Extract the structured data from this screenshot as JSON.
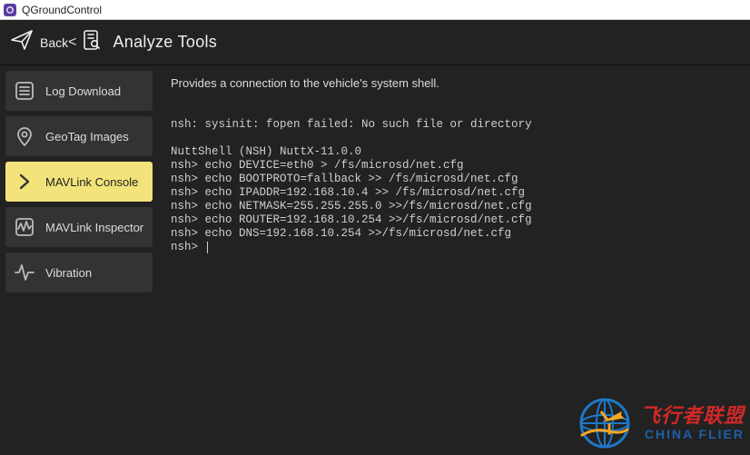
{
  "window": {
    "title": "QGroundControl"
  },
  "header": {
    "back_label": "Back",
    "chevron": "<",
    "page_title": "Analyze Tools"
  },
  "sidebar": {
    "items": [
      {
        "id": "log-download",
        "label": "Log Download",
        "icon": "list-lines-icon",
        "active": false
      },
      {
        "id": "geotag",
        "label": "GeoTag Images",
        "icon": "pin-icon",
        "active": false
      },
      {
        "id": "mavlink-console",
        "label": "MAVLink Console",
        "icon": "chevron-right-icon",
        "active": true
      },
      {
        "id": "mavlink-inspector",
        "label": "MAVLink Inspector",
        "icon": "waveform-box-icon",
        "active": false
      },
      {
        "id": "vibration",
        "label": "Vibration",
        "icon": "pulse-icon",
        "active": false
      }
    ]
  },
  "main": {
    "description": "Provides a connection to the vehicle's system shell.",
    "console_lines": [
      "nsh: sysinit: fopen failed: No such file or directory",
      "",
      "NuttShell (NSH) NuttX-11.0.0",
      "nsh> echo DEVICE=eth0 > /fs/microsd/net.cfg",
      "nsh> echo BOOTPROTO=fallback >> /fs/microsd/net.cfg",
      "nsh> echo IPADDR=192.168.10.4 >> /fs/microsd/net.cfg",
      "nsh> echo NETMASK=255.255.255.0 >>/fs/microsd/net.cfg",
      "nsh> echo ROUTER=192.168.10.254 >>/fs/microsd/net.cfg",
      "nsh> echo DNS=192.168.10.254 >>/fs/microsd/net.cfg"
    ],
    "prompt": "nsh> "
  },
  "watermark": {
    "line1": "飞行者联盟",
    "line2": "CHINA FLIER"
  },
  "colors": {
    "bg": "#222222",
    "panel": "#333333",
    "active": "#f2e47a",
    "text": "#dddddd",
    "watermark_red": "#d02828",
    "watermark_blue": "#1d5fa8"
  }
}
